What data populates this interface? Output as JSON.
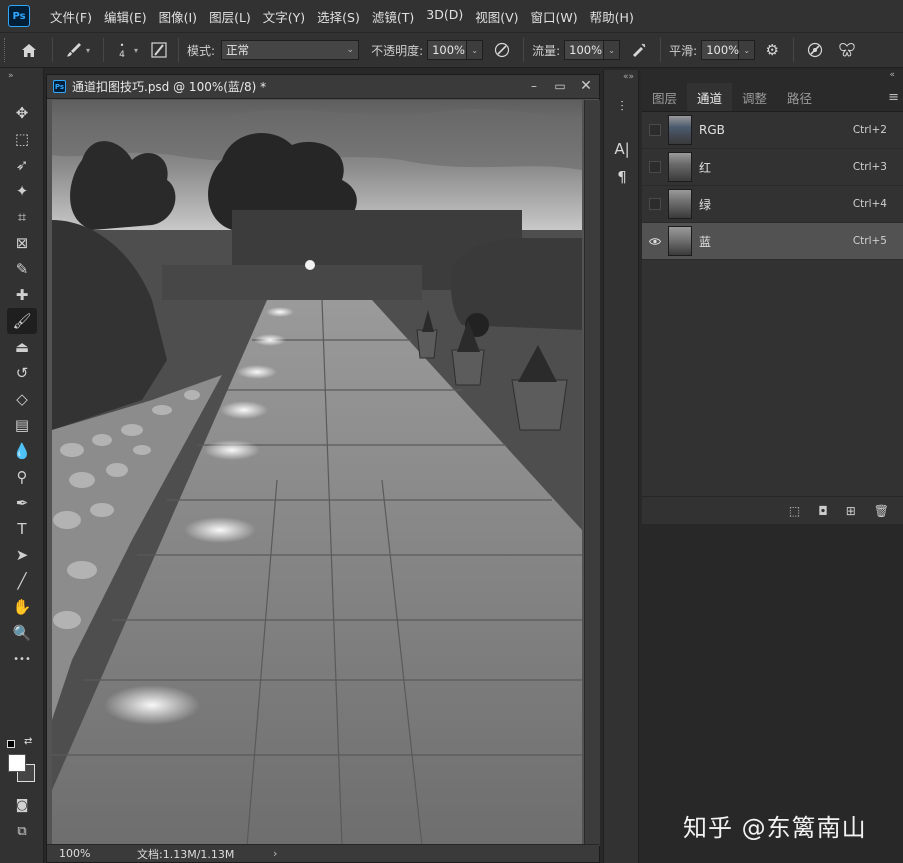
{
  "app": {
    "logo": "Ps"
  },
  "menu": [
    "文件(F)",
    "编辑(E)",
    "图像(I)",
    "图层(L)",
    "文字(Y)",
    "选择(S)",
    "滤镜(T)",
    "3D(D)",
    "视图(V)",
    "窗口(W)",
    "帮助(H)"
  ],
  "options": {
    "brush_size": "4",
    "mode_label": "模式:",
    "mode_value": "正常",
    "opacity_label": "不透明度:",
    "opacity_value": "100%",
    "flow_label": "流量:",
    "flow_value": "100%",
    "smoothing_label": "平滑:",
    "smoothing_value": "100%"
  },
  "tools": [
    {
      "name": "move-tool",
      "glyph": "✥"
    },
    {
      "name": "marquee-tool",
      "glyph": "⬚"
    },
    {
      "name": "lasso-tool",
      "glyph": "➶"
    },
    {
      "name": "magic-wand-tool",
      "glyph": "✦"
    },
    {
      "name": "crop-tool",
      "glyph": "⌗"
    },
    {
      "name": "frame-tool",
      "glyph": "⊠"
    },
    {
      "name": "eyedropper-tool",
      "glyph": "✎"
    },
    {
      "name": "healing-brush-tool",
      "glyph": "✚"
    },
    {
      "name": "brush-tool",
      "glyph": "🖌"
    },
    {
      "name": "clone-stamp-tool",
      "glyph": "⏏"
    },
    {
      "name": "history-brush-tool",
      "glyph": "↺"
    },
    {
      "name": "eraser-tool",
      "glyph": "◇"
    },
    {
      "name": "gradient-tool",
      "glyph": "▤"
    },
    {
      "name": "blur-tool",
      "glyph": "💧"
    },
    {
      "name": "dodge-tool",
      "glyph": "⚲"
    },
    {
      "name": "pen-tool",
      "glyph": "✒"
    },
    {
      "name": "type-tool",
      "glyph": "T"
    },
    {
      "name": "path-selection-tool",
      "glyph": "➤"
    },
    {
      "name": "line-tool",
      "glyph": "╱"
    },
    {
      "name": "hand-tool",
      "glyph": "✋"
    },
    {
      "name": "zoom-tool",
      "glyph": "🔍"
    },
    {
      "name": "more-tools",
      "glyph": "•••"
    }
  ],
  "document": {
    "title": "通道扣图技巧.psd @ 100%(蓝/8) *",
    "zoom": "100%",
    "doc_info": "文档:1.13M/1.13M"
  },
  "panel": {
    "tabs": [
      "图层",
      "通道",
      "调整",
      "路径"
    ],
    "active_tab": 1,
    "channels": [
      {
        "name": "RGB",
        "shortcut": "Ctrl+2",
        "visible": false,
        "selected": false,
        "tint": "#4a5a6e"
      },
      {
        "name": "红",
        "shortcut": "Ctrl+3",
        "visible": false,
        "selected": false,
        "tint": "#6a6a6a"
      },
      {
        "name": "绿",
        "shortcut": "Ctrl+4",
        "visible": false,
        "selected": false,
        "tint": "#707070"
      },
      {
        "name": "蓝",
        "shortcut": "Ctrl+5",
        "visible": true,
        "selected": true,
        "tint": "#777777"
      }
    ]
  },
  "watermark": "知乎 @东篱南山",
  "colors": {
    "ps_blue": "#31a8ff",
    "panel_bg": "#323232",
    "selected_row": "#525252"
  }
}
